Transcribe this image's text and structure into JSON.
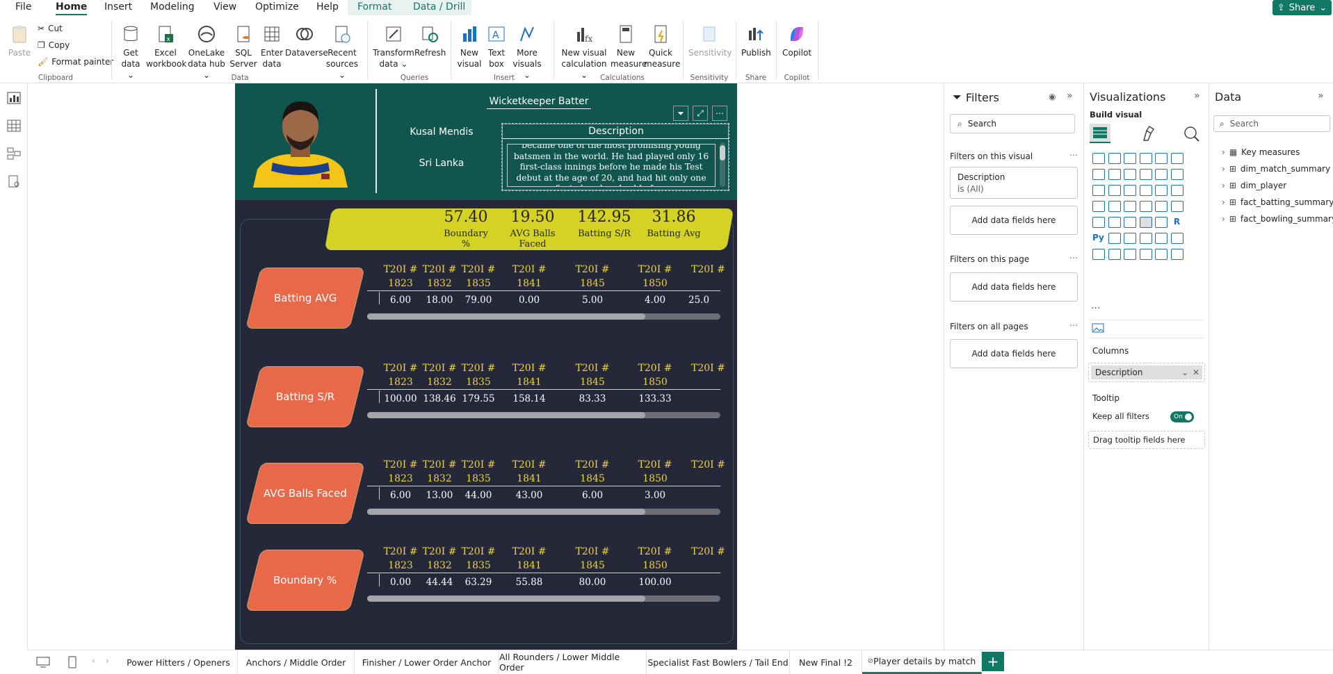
{
  "menu": {
    "tabs": [
      "File",
      "Home",
      "Insert",
      "Modeling",
      "View",
      "Optimize",
      "Help",
      "Format",
      "Data / Drill"
    ],
    "active": "Home",
    "share_label": "Share"
  },
  "ribbon": {
    "clipboard": {
      "paste": "Paste",
      "cut": "Cut",
      "copy": "Copy",
      "format_painter": "Format painter",
      "group": "Clipboard"
    },
    "data": {
      "get_data": "Get data",
      "excel": "Excel workbook",
      "onelake": "OneLake data hub",
      "sql": "SQL Server",
      "enter": "Enter data",
      "dataverse": "Dataverse",
      "recent": "Recent sources",
      "group": "Data"
    },
    "queries": {
      "transform": "Transform data",
      "refresh": "Refresh",
      "group": "Queries"
    },
    "insert": {
      "new_visual": "New visual",
      "text_box": "Text box",
      "more_visuals": "More visuals",
      "group": "Insert"
    },
    "calculations": {
      "new_visual_calc": "New visual calculation",
      "new_measure": "New measure",
      "quick_measure": "Quick measure",
      "group": "Calculations"
    },
    "sensitivity": {
      "label": "Sensitivity",
      "group": "Sensitivity"
    },
    "share": {
      "publish": "Publish",
      "group": "Share"
    },
    "copilot": {
      "label": "Copilot",
      "group": "Copilot"
    }
  },
  "report": {
    "role": "Wicketkeeper Batter",
    "player_name": "Kusal Mendis",
    "country": "Sri Lanka",
    "description_title": "Description",
    "description_text": "became one of the most promising young batsmen in the world. He had played only 16 first-class innings before he made his Test debut at the age of 20, and had hit only one first-class hundred before",
    "kpis": [
      {
        "value": "57.40",
        "label": "Boundary %"
      },
      {
        "value": "19.50",
        "label": "AVG Balls Faced"
      },
      {
        "value": "142.95",
        "label": "Batting S/R"
      },
      {
        "value": "31.86",
        "label": "Batting Avg"
      }
    ],
    "matches": [
      {
        "a": "T20I #",
        "b": "1823"
      },
      {
        "a": "T20I #",
        "b": "1832"
      },
      {
        "a": "T20I #",
        "b": "1835"
      },
      {
        "a": "T20I # 1841",
        "b": ""
      },
      {
        "a": "T20I # 1845",
        "b": ""
      },
      {
        "a": "T20I # 1850",
        "b": ""
      },
      {
        "a": "T20I #",
        "b": ""
      }
    ],
    "sections": [
      {
        "label": "Batting AVG",
        "values": [
          "6.00",
          "18.00",
          "79.00",
          "0.00",
          "5.00",
          "4.00",
          "25.0"
        ]
      },
      {
        "label": "Batting S/R",
        "values": [
          "100.00",
          "138.46",
          "179.55",
          "158.14",
          "83.33",
          "133.33",
          ""
        ]
      },
      {
        "label": "AVG Balls Faced",
        "values": [
          "6.00",
          "13.00",
          "44.00",
          "43.00",
          "6.00",
          "3.00",
          ""
        ]
      },
      {
        "label": "Boundary %",
        "values": [
          "0.00",
          "44.44",
          "63.29",
          "55.88",
          "80.00",
          "100.00",
          ""
        ]
      }
    ]
  },
  "filters": {
    "title": "Filters",
    "search_placeholder": "Search",
    "on_visual": "Filters on this visual",
    "card_field": "Description",
    "card_cond": "is (All)",
    "add_fields": "Add data fields here",
    "on_page": "Filters on this page",
    "on_all": "Filters on all pages"
  },
  "viz": {
    "title": "Visualizations",
    "build": "Build visual",
    "columns": "Columns",
    "column_field": "Description",
    "tooltip": "Tooltip",
    "keep_filters": "Keep all filters",
    "toggle": "On",
    "drag_tooltip": "Drag tooltip fields here",
    "more": "...",
    "py": "Py",
    "r": "R"
  },
  "data_pane": {
    "title": "Data",
    "search_placeholder": "Search",
    "tables": [
      "Key measures",
      "dim_match_summary",
      "dim_player",
      "fact_batting_summary",
      "fact_bowling_summary"
    ]
  },
  "pages": [
    "Power Hitters / Openers",
    "Anchors / Middle Order",
    "Finisher / Lower Order Anchor",
    "All Rounders / Lower Middle Order",
    "Specialist Fast Bowlers / Tail End",
    "New Final !2",
    "Player details by match"
  ],
  "active_page": "Player details by match",
  "add_page": "+",
  "colors": {
    "accent": "#117865",
    "header": "#10564f",
    "report_bg": "#252839",
    "kpi_bg": "#d5d226",
    "orange": "#e8694a",
    "gold": "#f0d43d"
  }
}
